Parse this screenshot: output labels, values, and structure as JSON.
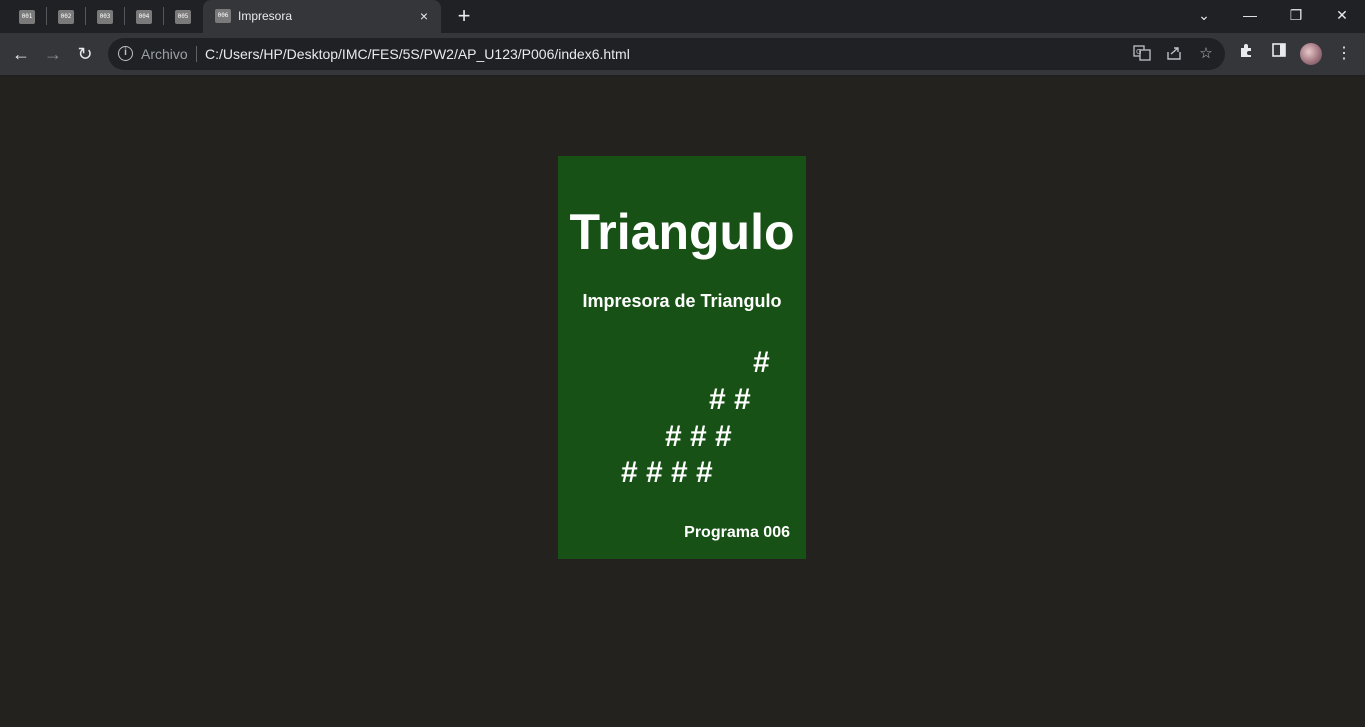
{
  "browser": {
    "tabs": [
      {
        "favicon_text": "001"
      },
      {
        "favicon_text": "002"
      },
      {
        "favicon_text": "003"
      },
      {
        "favicon_text": "004"
      },
      {
        "favicon_text": "005"
      }
    ],
    "active_tab": {
      "favicon_text": "006",
      "title": "Impresora",
      "close_icon": "×"
    },
    "new_tab_icon": "+",
    "window_controls": {
      "tab_search": "⌄",
      "minimize": "—",
      "restore": "❐",
      "close": "✕"
    },
    "nav": {
      "back": "←",
      "forward": "→",
      "reload": "↻"
    },
    "omnibox": {
      "origin_label": "Archivo",
      "url": "C:/Users/HP/Desktop/IMC/FES/5S/PW2/AP_U123/P006/index6.html"
    }
  },
  "page": {
    "title": "Triangulo",
    "subtitle": "Impresora de Triangulo",
    "triangle_rows": [
      "#",
      "# #",
      "# # #",
      "# # # #"
    ],
    "footer": "Programa 006",
    "colors": {
      "background": "#23221f",
      "card": "#185115",
      "text": "#ffffff"
    }
  }
}
